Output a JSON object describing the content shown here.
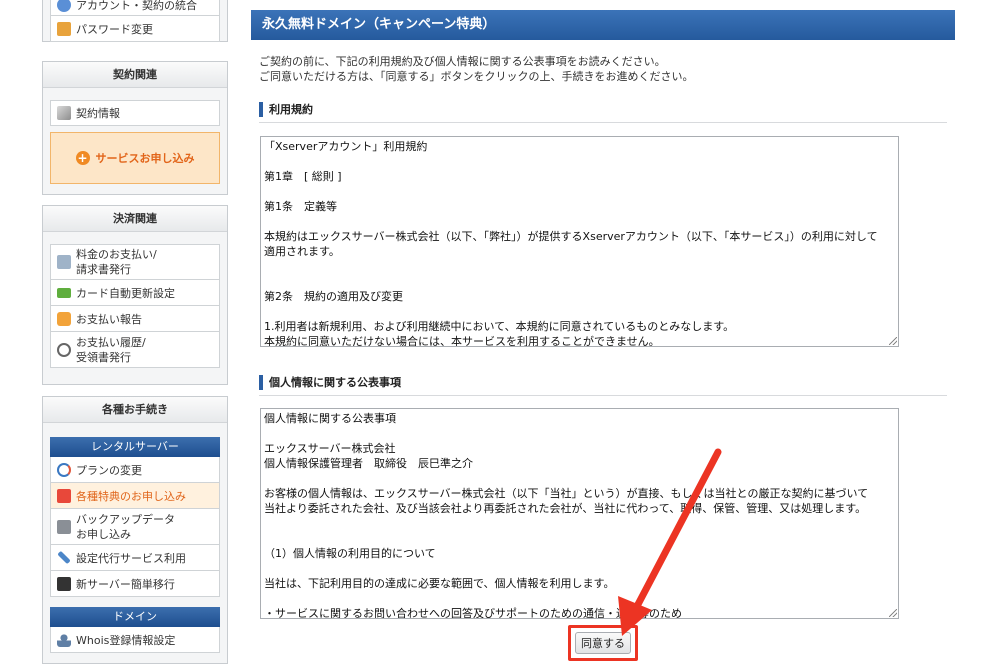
{
  "sidebar": {
    "account_panel": {
      "items": [
        {
          "label": "アカウント・契約の統合",
          "icon": "account-icon"
        },
        {
          "label": "パスワード変更",
          "icon": "lock-icon"
        }
      ]
    },
    "contract_panel": {
      "title": "契約関連",
      "items": [
        {
          "label": "契約情報",
          "icon": "document-icon"
        }
      ],
      "apply_button": "サービスお申し込み"
    },
    "payment_panel": {
      "title": "決済関連",
      "items": [
        {
          "label": "料金のお支払い/\n請求書発行",
          "icon": "invoice-icon"
        },
        {
          "label": "カード自動更新設定",
          "icon": "credit-card-icon"
        },
        {
          "label": "お支払い報告",
          "icon": "chat-icon"
        },
        {
          "label": "お支払い履歴/\n受領書発行",
          "icon": "clock-icon"
        }
      ]
    },
    "procedures_panel": {
      "title": "各種お手続き",
      "rental_header": "レンタルサーバー",
      "rental_items": [
        {
          "label": "プランの変更",
          "icon": "swap-icon"
        },
        {
          "label": "各種特典のお申し込み",
          "icon": "gift-icon",
          "active": true
        },
        {
          "label": "バックアップデータ\nお申し込み",
          "icon": "disk-icon"
        },
        {
          "label": "設定代行サービス利用",
          "icon": "wrench-icon"
        },
        {
          "label": "新サーバー簡単移行",
          "icon": "migrate-icon"
        }
      ],
      "domain_header": "ドメイン",
      "domain_items": [
        {
          "label": "Whois登録情報設定",
          "icon": "user-icon"
        }
      ]
    }
  },
  "main": {
    "title": "永久無料ドメイン（キャンペーン特典）",
    "intro_line1": "ご契約の前に、下記の利用規約及び個人情報に関する公表事項をお読みください。",
    "intro_line2": "ご同意いただける方は、「同意する」ボタンをクリックの上、手続きをお進めください。",
    "terms_heading": "利用規約",
    "terms_text": "「Xserverアカウント」利用規約\n\n第1章　[ 総則 ]\n\n第1条　定義等\n\n本規約はエックスサーバー株式会社（以下、「弊社」）が提供するXserverアカウント（以下、「本サービス」）の利用に対して\n適用されます。\n\n\n第2条　規約の適用及び変更\n\n1.利用者は新規利用、および利用継続中において、本規約に同意されているものとみなします。\n本規約に同意いただけない場合には、本サービスを利用することができません。",
    "privacy_heading": "個人情報に関する公表事項",
    "privacy_text": "個人情報に関する公表事項\n\nエックスサーバー株式会社\n個人情報保護管理者　取締役　辰巳準之介\n\nお客様の個人情報は、エックスサーバー株式会社（以下「当社」という）が直接、もしくは当社との厳正な契約に基づいて\n当社より委託された会社、及び当該会社より再委託された会社が、当社に代わって、取得、保管、管理、又は処理します。\n\n\n（1）個人情報の利用目的について\n\n当社は、下記利用目的の達成に必要な範囲で、個人情報を利用します。\n\n・サービスに関するお問い合わせへの回答及びサポートのための通信・連絡等のため",
    "agree_button": "同意する"
  },
  "colors": {
    "header_blue": "#255a9d",
    "highlight_red": "#ec3423",
    "accent_orange": "#e2651a"
  }
}
